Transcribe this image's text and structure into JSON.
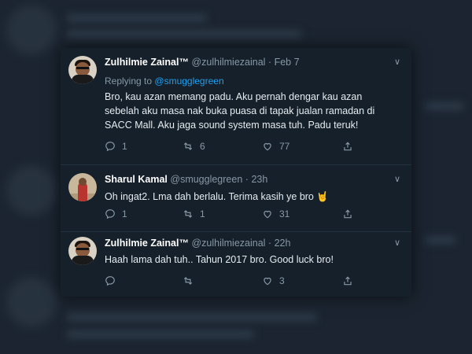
{
  "tweets": [
    {
      "name": "Zulhilmie Zainal™",
      "handle": "@zulhilmiezainal",
      "time": "Feb 7",
      "reply_prefix": "Replying to",
      "reply_mention": "@smugglegreen",
      "text": "Bro, kau azan memang padu. Aku pernah dengar kau azan sebelah aku masa nak buka puasa di tapak jualan ramadan di SACC Mall. Aku jaga sound system masa tuh. Padu teruk!",
      "replies": "1",
      "retweets": "6",
      "likes": "77"
    },
    {
      "name": "Sharul Kamal",
      "handle": "@smugglegreen",
      "time": "23h",
      "text": "Oh ingat2. Lma dah berlalu. Terima kasih ye bro 🤘",
      "replies": "1",
      "retweets": "1",
      "likes": "31"
    },
    {
      "name": "Zulhilmie Zainal™",
      "handle": "@zulhilmiezainal",
      "time": "22h",
      "text": "Haah lama dah tuh.. Tahun 2017 bro. Good luck bro!",
      "replies": "",
      "retweets": "",
      "likes": "3"
    }
  ],
  "separator": "·",
  "icons": [
    "reply-icon",
    "retweet-icon",
    "like-icon",
    "share-icon",
    "chevron-down-icon"
  ],
  "colors": {
    "background": "#15202b",
    "accent": "#1da1f2",
    "secondary_text": "#8899a6",
    "text": "#e6ecf0"
  }
}
